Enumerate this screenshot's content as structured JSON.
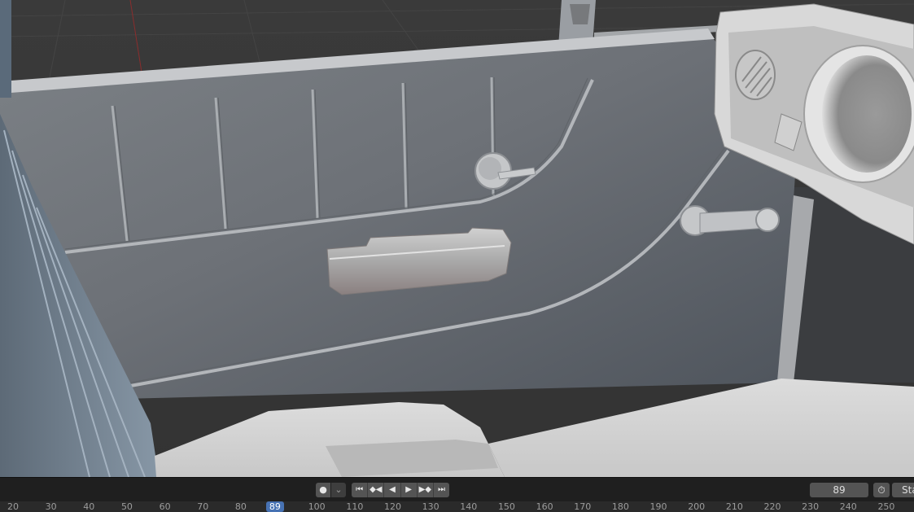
{
  "viewport": {
    "content": "car-door-interior-3d-model"
  },
  "playback": {
    "keyframe_icon": "record-dot-icon",
    "dropdown_icon": "chevron-down-icon",
    "buttons": [
      {
        "name": "jump-to-start",
        "glyph": "⏮"
      },
      {
        "name": "jump-to-prev-keyframe",
        "glyph": "◆◀"
      },
      {
        "name": "play-reverse",
        "glyph": "◀"
      },
      {
        "name": "play",
        "glyph": "▶"
      },
      {
        "name": "jump-to-next-keyframe",
        "glyph": "▶◆"
      },
      {
        "name": "jump-to-end",
        "glyph": "⏭"
      }
    ],
    "current_frame": "89",
    "timer_icon": "stopwatch-icon",
    "start_label": "Sta"
  },
  "timeline": {
    "ticks": [
      "20",
      "30",
      "40",
      "50",
      "60",
      "70",
      "80",
      "89",
      "100",
      "110",
      "120",
      "130",
      "140",
      "150",
      "160",
      "170",
      "180",
      "190",
      "200",
      "210",
      "220",
      "230",
      "240",
      "250"
    ],
    "current": "89"
  },
  "colors": {
    "accent": "#4772b3",
    "panel": "#1f1f1f",
    "button": "#545454"
  }
}
